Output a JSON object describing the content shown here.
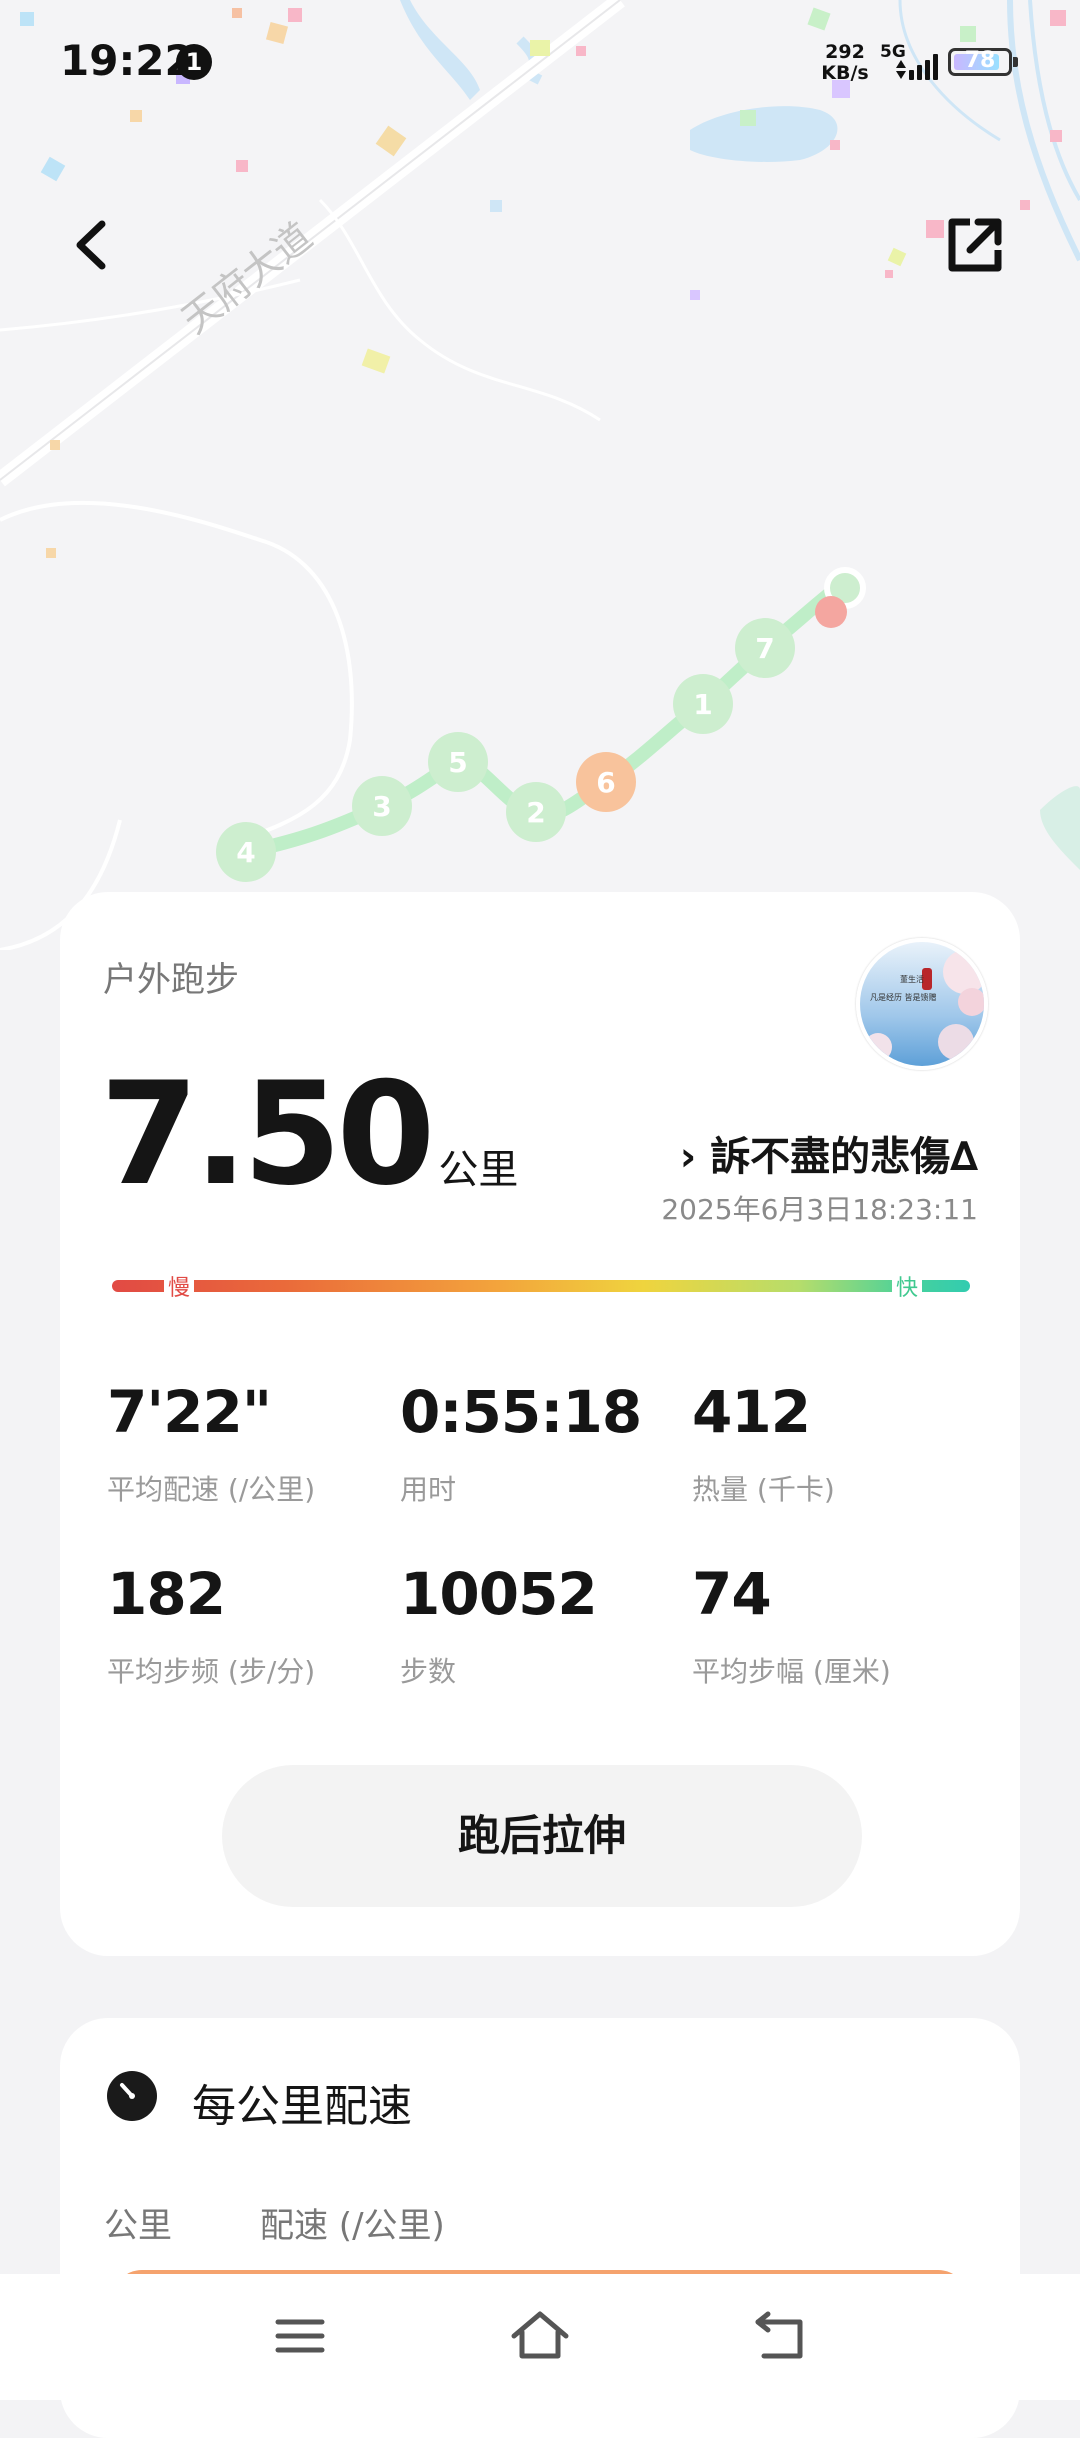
{
  "status_bar": {
    "time": "19:22",
    "notification_count": "1",
    "net_speed_value": "292",
    "net_speed_unit": "KB/s",
    "network": "5G",
    "battery": "78"
  },
  "map": {
    "road_label": "天府大道",
    "km_markers": [
      "4",
      "3",
      "5",
      "2",
      "6",
      "1",
      "7"
    ],
    "marker_colors": {
      "normal": "#cdeecf",
      "highlight": "#f8c39c",
      "end": "#f4a6a0",
      "route": "#bfeec8"
    }
  },
  "summary": {
    "sport_type": "户外跑步",
    "distance": "7.50",
    "distance_unit": "公里",
    "user_name": "訴不盡的悲傷∆",
    "user_prefix": "›",
    "datetime": "2025年6月3日18:23:11",
    "avatar_text_1": "董生活",
    "avatar_text_2": "凡是经历 皆是馈赠",
    "pace_slow": "慢",
    "pace_fast": "快",
    "stats": [
      {
        "value": "7'22\"",
        "label": "平均配速 (/公里)"
      },
      {
        "value": "0:55:18",
        "label": "用时"
      },
      {
        "value": "412",
        "label": "热量 (千卡)"
      },
      {
        "value": "182",
        "label": "平均步频 (步/分)"
      },
      {
        "value": "10052",
        "label": "步数"
      },
      {
        "value": "74",
        "label": "平均步幅 (厘米)"
      }
    ],
    "stretch_button": "跑后拉伸"
  },
  "pace_section": {
    "title": "每公里配速",
    "col_km": "公里",
    "col_pace": "配速 (/公里)"
  },
  "nav": {
    "icons": [
      "menu-icon",
      "home-icon",
      "back-nav-icon"
    ]
  }
}
